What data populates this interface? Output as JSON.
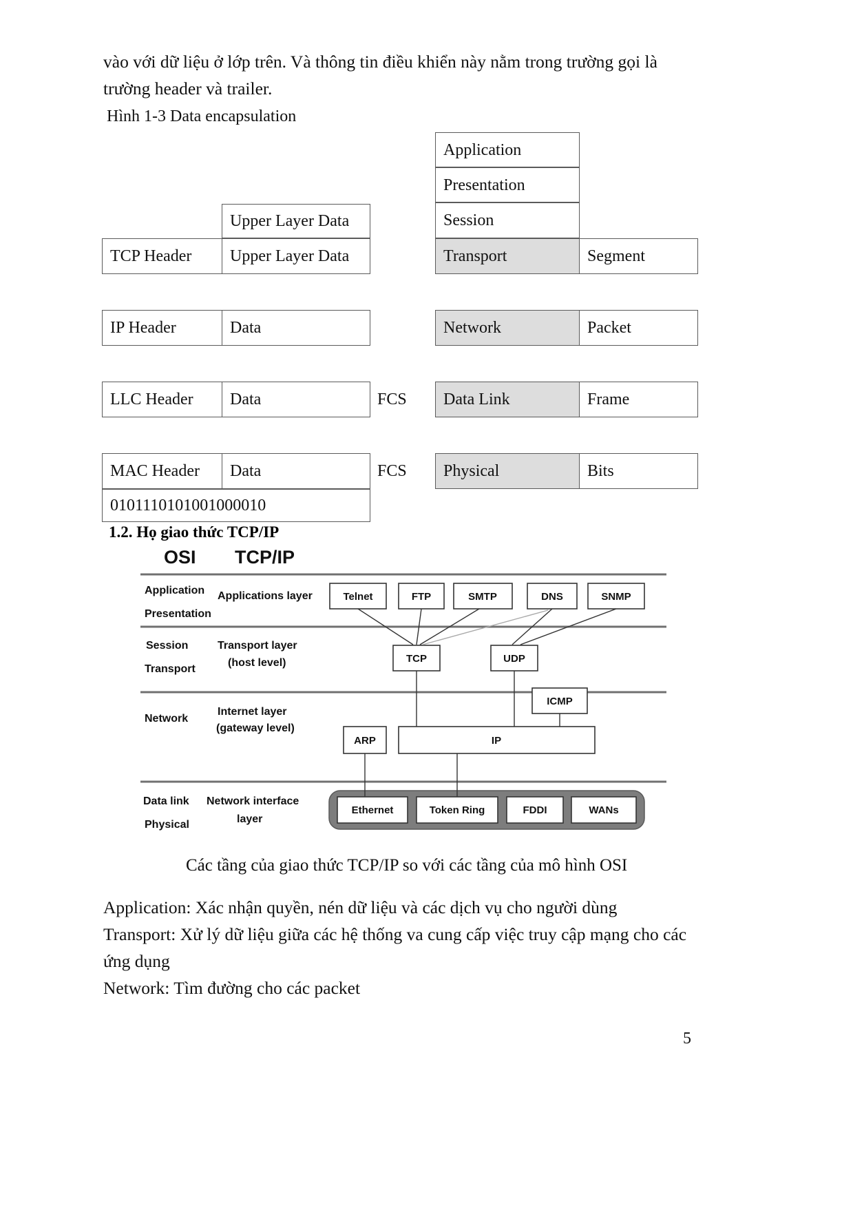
{
  "document": {
    "intro_paragraph": "vào với dữ liệu ở lớp trên. Và thông tin điều khiển này nằm trong trường gọi là trường header và trailer.",
    "figure_label": "Hình 1-3  Data  encapsulation",
    "section_heading": "1.2. Họ giao thức TCP/IP",
    "figure_caption": "Các tầng của giao thức TCP/IP so với các tầng của mô hình OSI",
    "page_number": "5",
    "tail_lines": [
      "Application: Xác nhận quyền, nén dữ liệu và các dịch vụ cho người dùng",
      "Transport: Xử lý dữ liệu giữa các hệ thống va cung cấp việc truy cập mạng cho các",
      "ứng dụng",
      "Network: Tìm đường cho các packet"
    ]
  },
  "encapsulation": {
    "osi_stack": [
      {
        "label": "Application",
        "shaded": false
      },
      {
        "label": "Presentation",
        "shaded": false
      },
      {
        "label": "Session",
        "shaded": false
      },
      {
        "label": "Transport",
        "shaded": true
      },
      {
        "label": "Network",
        "shaded": true
      },
      {
        "label": "Data Link",
        "shaded": true
      },
      {
        "label": "Physical",
        "shaded": true
      }
    ],
    "pdu_names": {
      "segment": "Segment",
      "packet": "Packet",
      "frame": "Frame",
      "bits": "Bits"
    },
    "upper_layer_data": "Upper Layer Data",
    "tcp_header": "TCP Header",
    "tcp_payload": "Upper Layer Data",
    "ip_header": "IP Header",
    "ip_payload": "Data",
    "llc_header": "LLC Header",
    "llc_payload": "Data",
    "llc_fcs": "FCS",
    "mac_header": "MAC Header",
    "mac_payload": "Data",
    "mac_fcs": "FCS",
    "bit_string": "0101110101001000010"
  },
  "osi_tcpip_figure": {
    "column_headers": {
      "osi": "OSI",
      "tcpip": "TCP/IP"
    },
    "osi_layers": {
      "application": "Application",
      "presentation": "Presentation",
      "session": "Session",
      "transport": "Transport",
      "network": "Network",
      "data_link": "Data link",
      "physical": "Physical"
    },
    "tcpip_layers": {
      "application": "Applications layer",
      "transport_l1": "Transport  layer",
      "transport_l2": "(host level)",
      "internet_l1": "Internet layer",
      "internet_l2": "(gateway level)",
      "netif_l1": "Network interface",
      "netif_l2": "layer"
    },
    "application_protocols": [
      "Telnet",
      "FTP",
      "SMTP",
      "DNS",
      "SNMP"
    ],
    "transport_protocols": [
      "TCP",
      "UDP"
    ],
    "internet_protocols": {
      "arp": "ARP",
      "ip": "IP",
      "icmp": "ICMP"
    },
    "network_interfaces": [
      "Ethernet",
      "Token Ring",
      "FDDI",
      "WANs"
    ]
  },
  "colors": {
    "shaded_cell": "#dddddd",
    "cell_border": "#5a5a5a",
    "text": "#111111",
    "figure_band": "#707070"
  }
}
